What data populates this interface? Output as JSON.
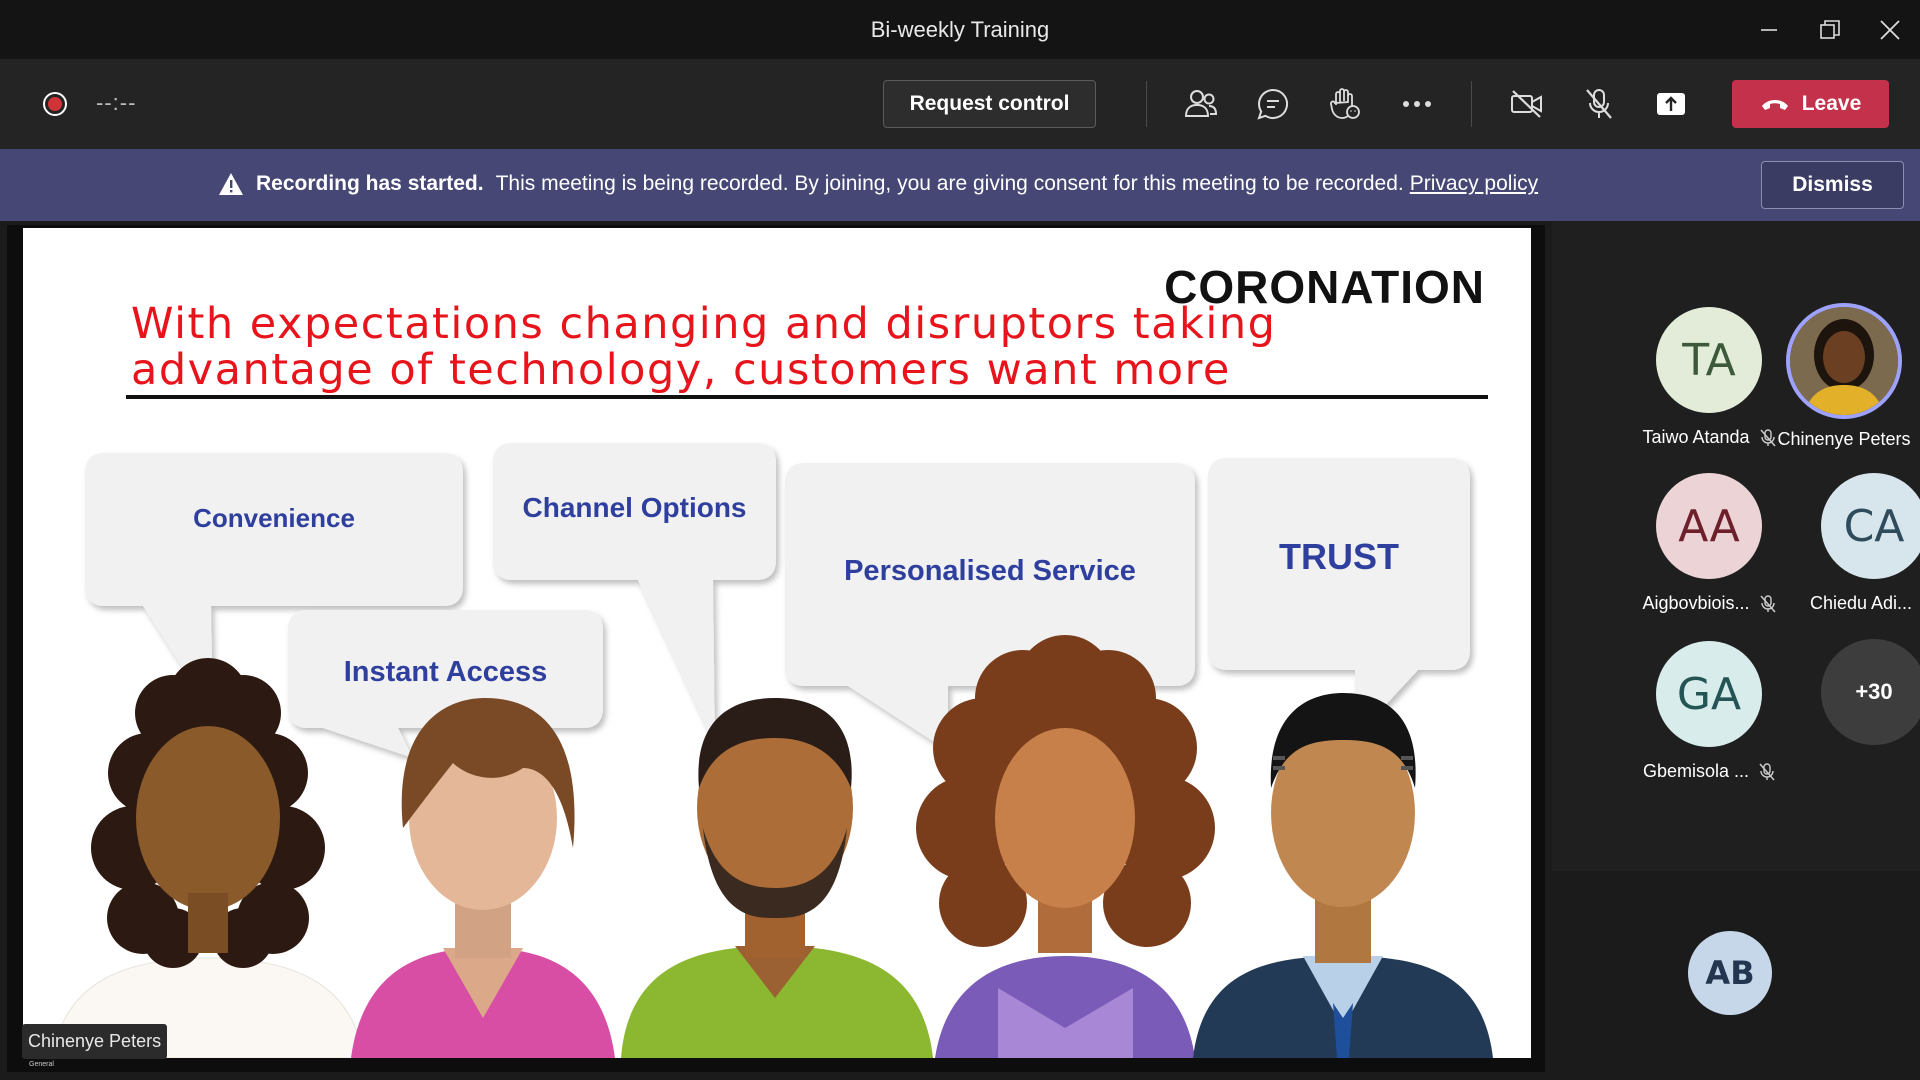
{
  "window": {
    "title": "Bi-weekly Training"
  },
  "toolbar": {
    "timer": "--:--",
    "request_control_label": "Request control",
    "leave_label": "Leave",
    "icons": [
      "people-icon",
      "chat-icon",
      "raise-hand-icon",
      "more-icon",
      "camera-off-icon",
      "mic-off-icon",
      "share-icon"
    ]
  },
  "banner": {
    "bold": "Recording has started.",
    "message": "This meeting is being recorded. By joining, you are giving consent for this meeting to be recorded.",
    "link": "Privacy policy",
    "dismiss_label": "Dismiss",
    "color": "#464775"
  },
  "slide": {
    "brand": "CORONATION",
    "headline": "With expectations changing and disruptors taking advantage of technology, customers want more",
    "bubbles": {
      "convenience": "Convenience",
      "channel_options": "Channel Options",
      "instant_access": "Instant Access",
      "personalised_service": "Personalised Service",
      "trust": "TRUST"
    }
  },
  "presenter": {
    "name": "Chinenye Peters",
    "sub": "General"
  },
  "participants": [
    {
      "initials": "TA",
      "name": "Taiwo Atanda",
      "muted": true,
      "bg": "#e3ecd9",
      "fg": "#3c5a3a"
    },
    {
      "initials": "",
      "name": "Chinenye Peters",
      "muted": false,
      "bg": "#6b4a2f",
      "fg": "#fff"
    },
    {
      "initials": "AA",
      "name": "Aigbovbiois...",
      "muted": true,
      "bg": "#ecd3d6",
      "fg": "#6d1f2b"
    },
    {
      "initials": "CA",
      "name": "Chiedu Adi...",
      "muted": true,
      "bg": "#d7e5ec",
      "fg": "#2f4c5c"
    },
    {
      "initials": "GA",
      "name": "Gbemisola ...",
      "muted": true,
      "bg": "#d8ecec",
      "fg": "#245454"
    },
    {
      "initials": "+30",
      "name": "",
      "muted": false,
      "bg": "#3d3d3d",
      "fg": "#fff"
    }
  ],
  "self": {
    "initials": "AB"
  },
  "colors": {
    "accent_red": "#c4314b",
    "headline_red": "#e8141c",
    "bubble_text": "#2e3f9e"
  }
}
